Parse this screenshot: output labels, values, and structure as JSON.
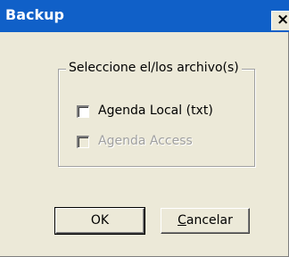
{
  "window": {
    "title": "Backup",
    "close_glyph": "×",
    "titlebar_color": "#1060c8",
    "background_color": "#ece9d8"
  },
  "group": {
    "legend": "Seleccione el/los archivo(s)",
    "options": [
      {
        "label": "Agenda Local (txt)",
        "checked": false,
        "enabled": true
      },
      {
        "label": "Agenda Access",
        "checked": false,
        "enabled": false
      }
    ]
  },
  "buttons": {
    "ok_label": "OK",
    "cancel_label": "Cancelar"
  }
}
